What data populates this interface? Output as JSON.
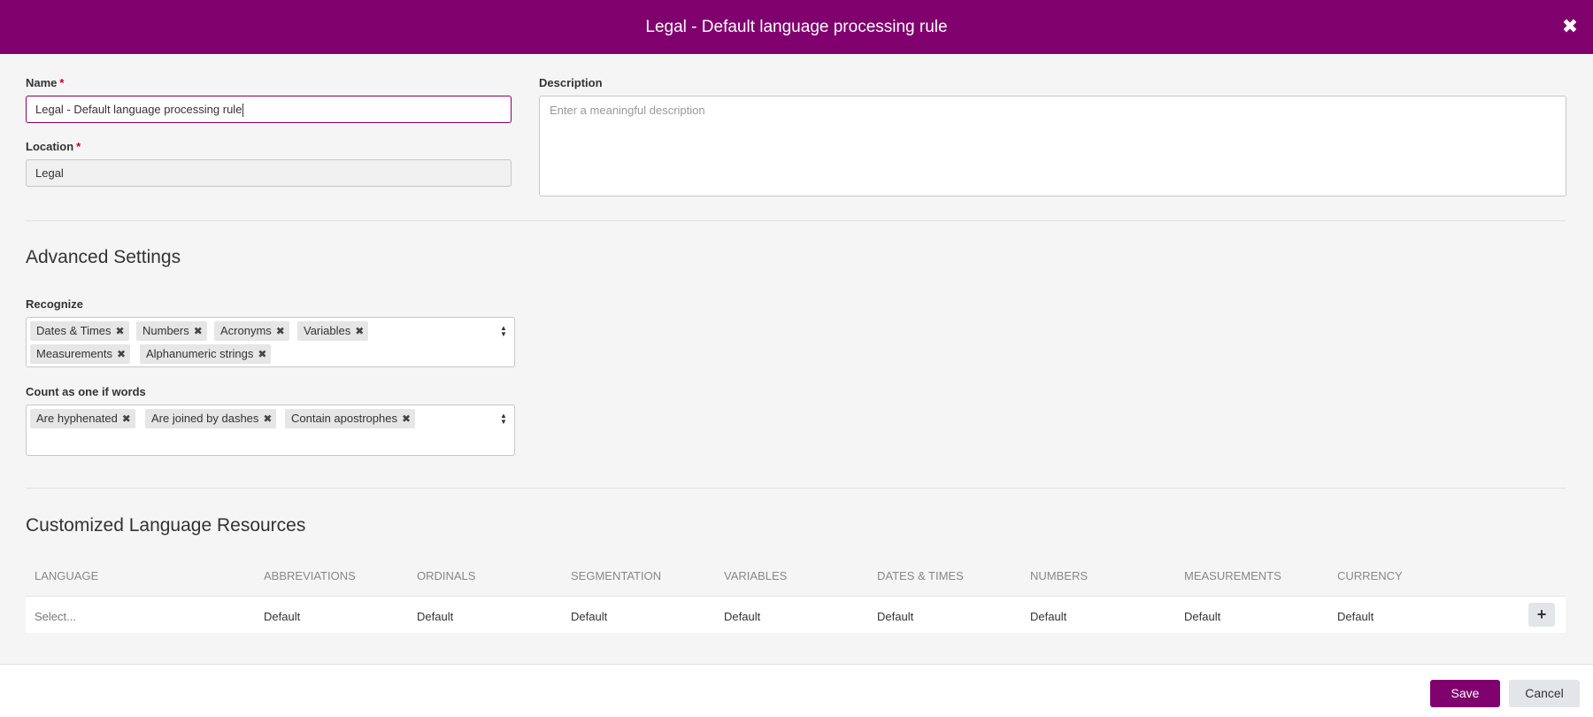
{
  "header": {
    "title": "Legal - Default language processing rule",
    "close_icon": "close-icon"
  },
  "form": {
    "name_label": "Name",
    "required_mark": "*",
    "name_value": "Legal - Default language processing rule",
    "location_label": "Location",
    "location_value": "Legal",
    "description_label": "Description",
    "description_placeholder": "Enter a meaningful description"
  },
  "advanced": {
    "title": "Advanced Settings",
    "recognize_label": "Recognize",
    "recognize_tags": [
      "Dates & Times",
      "Numbers",
      "Acronyms",
      "Variables",
      "Measurements",
      "Alphanumeric strings"
    ],
    "count_label": "Count as one if words",
    "count_tags": [
      "Are hyphenated",
      "Are joined by dashes",
      "Contain apostrophes"
    ],
    "remove_icon": "remove-tag-icon",
    "sort_icon": "sort-arrows-icon"
  },
  "resources": {
    "title": "Customized Language Resources",
    "columns": [
      "LANGUAGE",
      "ABBREVIATIONS",
      "ORDINALS",
      "SEGMENTATION",
      "VARIABLES",
      "DATES & TIMES",
      "NUMBERS",
      "MEASUREMENTS",
      "CURRENCY"
    ],
    "row": [
      "Select...",
      "Default",
      "Default",
      "Default",
      "Default",
      "Default",
      "Default",
      "Default",
      "Default"
    ],
    "add_icon": "plus-icon"
  },
  "footer": {
    "save_label": "Save",
    "cancel_label": "Cancel"
  },
  "colors": {
    "brand": "#80006e",
    "required": "#c8002a"
  }
}
